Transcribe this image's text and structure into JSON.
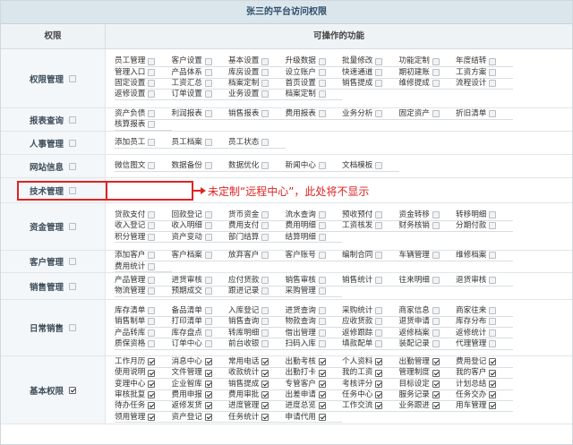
{
  "title": "张三的平台访问权限",
  "header": {
    "col1": "权限",
    "col2": "可操作的功能"
  },
  "annotation": "未定制“远程中心”，此处将不显示",
  "colors": {
    "accent": "#e02222",
    "header_bg": "#dbe6ec"
  },
  "rows": [
    {
      "label": "权限管理",
      "checked": false,
      "items": [
        {
          "t": "员工管理",
          "c": false
        },
        {
          "t": "客户设置",
          "c": false
        },
        {
          "t": "基本设置",
          "c": false
        },
        {
          "t": "升级数据",
          "c": false
        },
        {
          "t": "批量修改",
          "c": false
        },
        {
          "t": "功能定制",
          "c": false
        },
        {
          "t": "年度结转",
          "c": false
        },
        {
          "t": "管理入口",
          "c": false
        },
        {
          "t": "产品体系",
          "c": false
        },
        {
          "t": "库房设置",
          "c": false
        },
        {
          "t": "设立账户",
          "c": false
        },
        {
          "t": "快速通道",
          "c": false
        },
        {
          "t": "期初建账",
          "c": false
        },
        {
          "t": "工资方案",
          "c": false
        },
        {
          "t": "固定设置",
          "c": false
        },
        {
          "t": "工资汇总",
          "c": false
        },
        {
          "t": "档案定制",
          "c": false
        },
        {
          "t": "首页设置",
          "c": false
        },
        {
          "t": "销售提成",
          "c": false
        },
        {
          "t": "维修提成",
          "c": false
        },
        {
          "t": "流程设计",
          "c": false
        },
        {
          "t": "返修设置",
          "c": false
        },
        {
          "t": "订单设置",
          "c": false
        },
        {
          "t": "业务设置",
          "c": false
        },
        {
          "t": "档案定制",
          "c": false
        }
      ]
    },
    {
      "label": "报表查询",
      "checked": false,
      "items": [
        {
          "t": "资产负债",
          "c": false
        },
        {
          "t": "利润报表",
          "c": false
        },
        {
          "t": "销售报表",
          "c": false
        },
        {
          "t": "费用报表",
          "c": false
        },
        {
          "t": "业务分析",
          "c": false
        },
        {
          "t": "固定资产",
          "c": false
        },
        {
          "t": "折旧清单",
          "c": false
        },
        {
          "t": "核算报表",
          "c": false
        }
      ]
    },
    {
      "label": "人事管理",
      "checked": false,
      "items": [
        {
          "t": "添加员工",
          "c": false
        },
        {
          "t": "员工档案",
          "c": false
        },
        {
          "t": "员工状态",
          "c": false
        }
      ]
    },
    {
      "label": "网站信息",
      "checked": false,
      "items": [
        {
          "t": "微信图文",
          "c": false
        },
        {
          "t": "数据备份",
          "c": false
        },
        {
          "t": "数据优化",
          "c": false
        },
        {
          "t": "新闻中心",
          "c": false
        },
        {
          "t": "文档模板",
          "c": false
        }
      ]
    },
    {
      "label": "技术管理",
      "checked": false,
      "items": []
    },
    {
      "label": "资金管理",
      "checked": false,
      "items": [
        {
          "t": "贷款支付",
          "c": false
        },
        {
          "t": "回款登记",
          "c": false
        },
        {
          "t": "货币资金",
          "c": false
        },
        {
          "t": "流水查询",
          "c": false
        },
        {
          "t": "预收预付",
          "c": false
        },
        {
          "t": "资金转移",
          "c": false
        },
        {
          "t": "转移明细",
          "c": false
        },
        {
          "t": "收入登记",
          "c": false
        },
        {
          "t": "收入明细",
          "c": false
        },
        {
          "t": "费用支付",
          "c": false
        },
        {
          "t": "费用明细",
          "c": false
        },
        {
          "t": "工资核发",
          "c": false
        },
        {
          "t": "财务核销",
          "c": false
        },
        {
          "t": "分期付款",
          "c": false
        },
        {
          "t": "积分管理",
          "c": false
        },
        {
          "t": "资产变动",
          "c": false
        },
        {
          "t": "部门结算",
          "c": false
        },
        {
          "t": "结算明细",
          "c": false
        }
      ]
    },
    {
      "label": "客户管理",
      "checked": false,
      "items": [
        {
          "t": "添加客户",
          "c": false
        },
        {
          "t": "客户档案",
          "c": false
        },
        {
          "t": "放弃客户",
          "c": false
        },
        {
          "t": "客户账号",
          "c": false
        },
        {
          "t": "编制合同",
          "c": false
        },
        {
          "t": "车辆管理",
          "c": false
        },
        {
          "t": "维修档案",
          "c": false
        },
        {
          "t": "费用统计",
          "c": false
        }
      ]
    },
    {
      "label": "销售管理",
      "checked": false,
      "items": [
        {
          "t": "产品管理",
          "c": false
        },
        {
          "t": "进货审核",
          "c": false
        },
        {
          "t": "应付货款",
          "c": false
        },
        {
          "t": "销售审核",
          "c": false
        },
        {
          "t": "销售统计",
          "c": false
        },
        {
          "t": "往来明细",
          "c": false
        },
        {
          "t": "退货审核",
          "c": false
        },
        {
          "t": "物流管理",
          "c": false
        },
        {
          "t": "预期成交",
          "c": false
        },
        {
          "t": "跟进记录",
          "c": false
        },
        {
          "t": "采购管理",
          "c": false
        }
      ]
    },
    {
      "label": "日常销售",
      "checked": false,
      "items": [
        {
          "t": "库存清单",
          "c": false
        },
        {
          "t": "备品清单",
          "c": false
        },
        {
          "t": "入库登记",
          "c": false
        },
        {
          "t": "进货查询",
          "c": false
        },
        {
          "t": "采购统计",
          "c": false
        },
        {
          "t": "商家信息",
          "c": false
        },
        {
          "t": "商家往来",
          "c": false
        },
        {
          "t": "销售制单",
          "c": false
        },
        {
          "t": "打印清单",
          "c": false
        },
        {
          "t": "销售查询",
          "c": false
        },
        {
          "t": "物款查询",
          "c": false
        },
        {
          "t": "应收货款",
          "c": false
        },
        {
          "t": "退货申请",
          "c": false
        },
        {
          "t": "库存分布",
          "c": false
        },
        {
          "t": "产品转库",
          "c": false
        },
        {
          "t": "库存盘点",
          "c": false
        },
        {
          "t": "转库明细",
          "c": false
        },
        {
          "t": "借出管理",
          "c": false
        },
        {
          "t": "返修跟踪",
          "c": false
        },
        {
          "t": "返修档案",
          "c": false
        },
        {
          "t": "返修统计",
          "c": false
        },
        {
          "t": "质保资格",
          "c": false
        },
        {
          "t": "订单中心",
          "c": false
        },
        {
          "t": "前台收银",
          "c": false
        },
        {
          "t": "扫码入库",
          "c": false
        },
        {
          "t": "填款配单",
          "c": false
        },
        {
          "t": "装配记录",
          "c": false
        },
        {
          "t": "代理管理",
          "c": false
        }
      ]
    },
    {
      "label": "基本权限",
      "checked": true,
      "items": [
        {
          "t": "工作月历",
          "c": true
        },
        {
          "t": "消息中心",
          "c": true
        },
        {
          "t": "常用电话",
          "c": true
        },
        {
          "t": "出勤考核",
          "c": true
        },
        {
          "t": "个人资料",
          "c": true
        },
        {
          "t": "出勤管理",
          "c": true
        },
        {
          "t": "费用登记",
          "c": true
        },
        {
          "t": "使用说明",
          "c": true
        },
        {
          "t": "文件管理",
          "c": true
        },
        {
          "t": "收款统计",
          "c": true
        },
        {
          "t": "出勤打卡",
          "c": true
        },
        {
          "t": "我的工资",
          "c": true
        },
        {
          "t": "管理制度",
          "c": true
        },
        {
          "t": "我的客户",
          "c": true
        },
        {
          "t": "变理中心",
          "c": true
        },
        {
          "t": "企业智库",
          "c": true
        },
        {
          "t": "销售提成",
          "c": true
        },
        {
          "t": "专管客户",
          "c": true
        },
        {
          "t": "考核评分",
          "c": true
        },
        {
          "t": "目标设定",
          "c": true
        },
        {
          "t": "计划总结",
          "c": true
        },
        {
          "t": "审核批复",
          "c": true
        },
        {
          "t": "费用申报",
          "c": true
        },
        {
          "t": "费用审批",
          "c": true
        },
        {
          "t": "出差申请",
          "c": true
        },
        {
          "t": "任务中心",
          "c": true
        },
        {
          "t": "服务记录",
          "c": true
        },
        {
          "t": "任务交办",
          "c": true
        },
        {
          "t": "待办任务",
          "c": true
        },
        {
          "t": "返修发货",
          "c": true
        },
        {
          "t": "进度管理",
          "c": true
        },
        {
          "t": "进度总览",
          "c": true
        },
        {
          "t": "工作交流",
          "c": true
        },
        {
          "t": "业务跟进",
          "c": true
        },
        {
          "t": "用车管理",
          "c": true
        },
        {
          "t": "领用管理",
          "c": true
        },
        {
          "t": "资产登记",
          "c": true
        },
        {
          "t": "任务统计",
          "c": true
        },
        {
          "t": "申请代用",
          "c": true
        }
      ]
    }
  ]
}
